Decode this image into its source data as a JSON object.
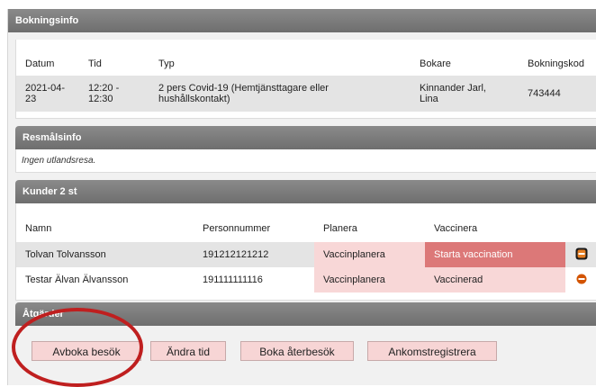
{
  "header": {
    "title": "Bokningsinfo"
  },
  "booking": {
    "columns": [
      "Datum",
      "Tid",
      "Typ",
      "Bokare",
      "Bokningskod"
    ],
    "row": {
      "datum": "2021-04-\n23",
      "tid": "12:20 -\n12:30",
      "typ": "2 pers Covid-19 (Hemtjänsttagare eller\nhushållskontakt)",
      "bokare": "Kinnander Jarl,\nLina",
      "bokningskod": "743444"
    }
  },
  "resmal": {
    "title": "Resmålsinfo",
    "text": "Ingen utlandsresa."
  },
  "kunder": {
    "title": "Kunder 2 st",
    "columns": [
      "Namn",
      "Personnummer",
      "Planera",
      "Vaccinera"
    ],
    "rows": [
      {
        "namn": "Tolvan Tolvansson",
        "personnummer": "191212121212",
        "planera": "Vaccinplanera",
        "vaccinera": "Starta vaccination",
        "action_icon": "remove-box-icon"
      },
      {
        "namn": "Testar Älvan Älvansson",
        "personnummer": "191111111116",
        "planera": "Vaccinplanera",
        "vaccinera": "Vaccinerad",
        "action_icon": "remove-circle-icon"
      }
    ]
  },
  "atgarder": {
    "title": "Åtgärder",
    "buttons": [
      "Avboka besök",
      "Ändra tid",
      "Boka återbesök",
      "Ankomstregistrera"
    ]
  },
  "colors": {
    "header": "#7a7a7a",
    "row_highlight": "#e4e4e4",
    "pink_cell": "#f8d7d7",
    "start_cell": "#dc7878",
    "button": "#f7d5d5",
    "annotation_circle": "#bf1f1f",
    "remove_icon": "#d35400"
  }
}
